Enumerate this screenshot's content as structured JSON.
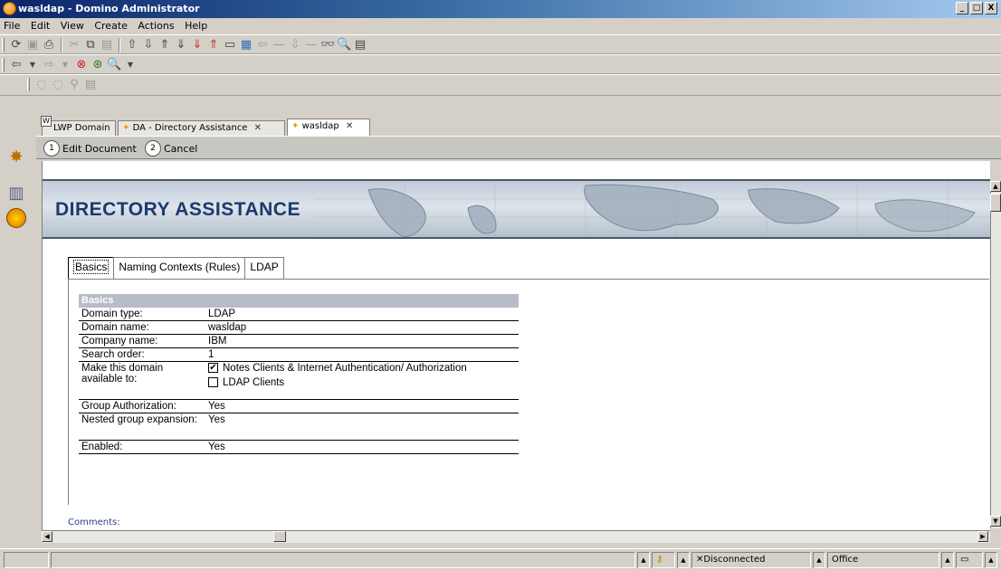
{
  "window": {
    "title": "wasldap - Domino Administrator",
    "controls": [
      "_",
      "□",
      "X"
    ]
  },
  "menu": [
    "File",
    "Edit",
    "View",
    "Create",
    "Actions",
    "Help"
  ],
  "window_tabs": [
    {
      "label": "LWP Domain",
      "icon": "domain-icon"
    },
    {
      "label": "DA - Directory Assistance",
      "icon": "directory-assistance-icon",
      "closable": true
    },
    {
      "label": "wasldap",
      "icon": "document-icon",
      "closable": true,
      "active": true
    }
  ],
  "actions": {
    "edit_document": "Edit Document",
    "cancel": "Cancel"
  },
  "banner": {
    "title": "DIRECTORY ASSISTANCE"
  },
  "form_tabs": [
    "Basics",
    "Naming Contexts (Rules)",
    "LDAP"
  ],
  "basics": {
    "header": "Basics",
    "domain_type_label": "Domain type:",
    "domain_type_value": "LDAP",
    "domain_name_label": "Domain name:",
    "domain_name_value": "wasldap",
    "company_name_label": "Company name:",
    "company_name_value": "IBM",
    "search_order_label": "Search order:",
    "search_order_value": "1",
    "available_to_label": "Make this domain available to:",
    "available_to_options": [
      {
        "label": "Notes Clients & Internet Authentication/ Authorization",
        "checked": true
      },
      {
        "label": "LDAP Clients",
        "checked": false
      }
    ],
    "group_auth_label": "Group Authorization:",
    "group_auth_value": "Yes",
    "nested_label": "Nested group expansion:",
    "nested_value": "Yes",
    "enabled_label": "Enabled:",
    "enabled_value": "Yes"
  },
  "comments_label": "Comments:",
  "status": {
    "connection": "Disconnected",
    "location": "Office"
  },
  "colors": {
    "title_bar": "#0a246a",
    "banner_title": "#1c3a6e",
    "basics_header": "#b8bcc8"
  }
}
